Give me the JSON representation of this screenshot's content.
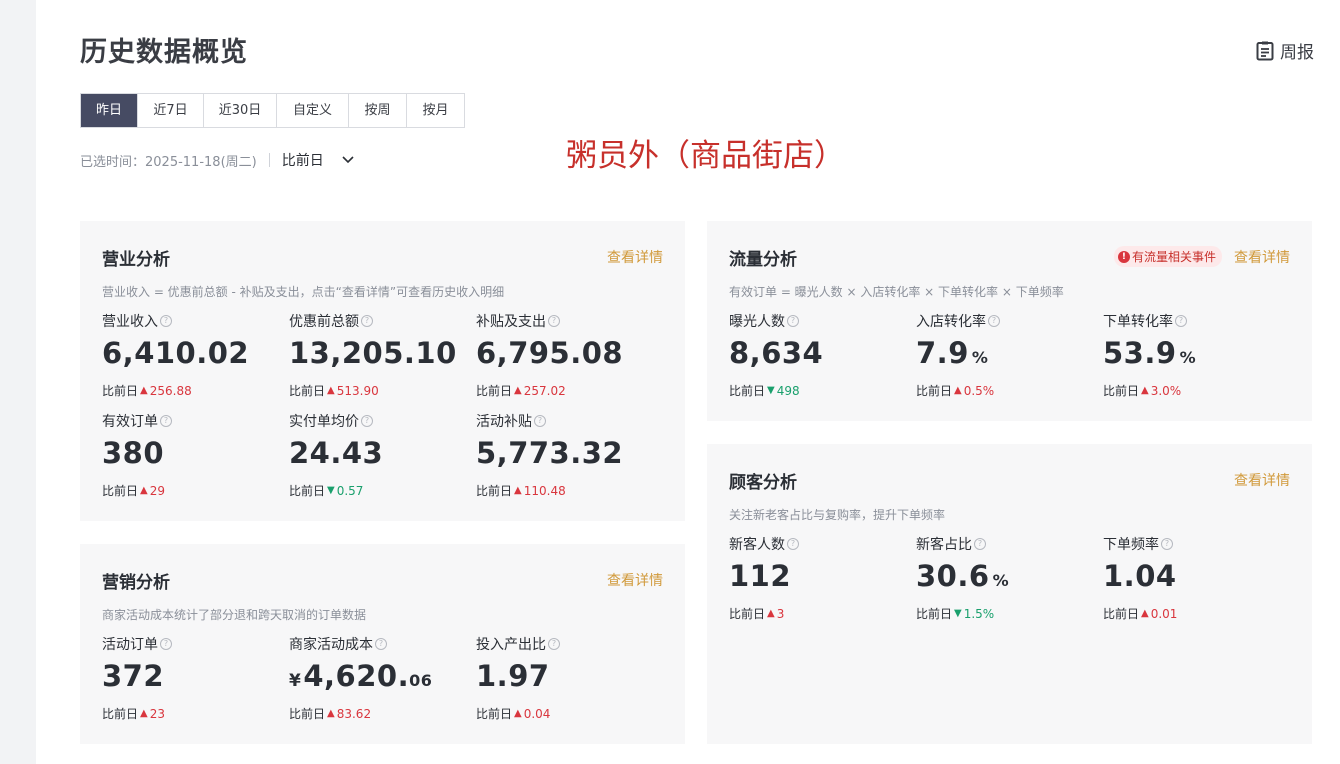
{
  "header": {
    "title": "历史数据概览",
    "weekly_label": "周报"
  },
  "tabs": [
    {
      "label": "昨日",
      "active": true
    },
    {
      "label": "近7日"
    },
    {
      "label": "近30日"
    },
    {
      "label": "自定义"
    },
    {
      "label": "按周"
    },
    {
      "label": "按月"
    }
  ],
  "selected": {
    "label": "已选时间：",
    "date": "2025-11-18(周二)",
    "compare": "比前日"
  },
  "shop_name": "粥员外（商品街店）",
  "colors": {
    "up": "#d9363e",
    "down": "#1aa06d",
    "link": "#d19a3b",
    "active_tab": "#464b63",
    "shop_name": "#c7302b"
  },
  "business": {
    "title": "营业分析",
    "link": "查看详情",
    "desc": "营业收入 = 优惠前总额 - 补贴及支出，点击“查看详情”可查看历史收入明细",
    "metrics": [
      {
        "label": "营业收入",
        "value": "6,410.02",
        "cmp_label": "比前日",
        "dir": "up",
        "delta": "256.88"
      },
      {
        "label": "优惠前总额",
        "value": "13,205.10",
        "cmp_label": "比前日",
        "dir": "up",
        "delta": "513.90"
      },
      {
        "label": "补贴及支出",
        "value": "6,795.08",
        "cmp_label": "比前日",
        "dir": "up",
        "delta": "257.02"
      },
      {
        "label": "有效订单",
        "value": "380",
        "cmp_label": "比前日",
        "dir": "up",
        "delta": "29"
      },
      {
        "label": "实付单均价",
        "value": "24.43",
        "cmp_label": "比前日",
        "dir": "down",
        "delta": "0.57"
      },
      {
        "label": "活动补贴",
        "value": "5,773.32",
        "cmp_label": "比前日",
        "dir": "up",
        "delta": "110.48"
      }
    ]
  },
  "marketing": {
    "title": "营销分析",
    "link": "查看详情",
    "desc": "商家活动成本统计了部分退和跨天取消的订单数据",
    "metrics": [
      {
        "label": "活动订单",
        "value": "372",
        "cmp_label": "比前日",
        "dir": "up",
        "delta": "23"
      },
      {
        "label": "商家活动成本",
        "currency": "¥",
        "value": "4,620.",
        "decimal": "06",
        "cmp_label": "比前日",
        "dir": "up",
        "delta": "83.62"
      },
      {
        "label": "投入产出比",
        "value": "1.97",
        "cmp_label": "比前日",
        "dir": "up",
        "delta": "0.04"
      }
    ]
  },
  "traffic": {
    "title": "流量分析",
    "link": "查看详情",
    "badge": "有流量相关事件",
    "desc": "有效订单 = 曝光人数 × 入店转化率 × 下单转化率 × 下单频率",
    "metrics": [
      {
        "label": "曝光人数",
        "value": "8,634",
        "cmp_label": "比前日",
        "dir": "down",
        "delta": "498"
      },
      {
        "label": "入店转化率",
        "value": "7.9",
        "unit": "%",
        "cmp_label": "比前日",
        "dir": "up",
        "delta": "0.5%"
      },
      {
        "label": "下单转化率",
        "value": "53.9",
        "unit": "%",
        "cmp_label": "比前日",
        "dir": "up",
        "delta": "3.0%"
      }
    ]
  },
  "customer": {
    "title": "顾客分析",
    "link": "查看详情",
    "desc": "关注新老客占比与复购率，提升下单频率",
    "metrics": [
      {
        "label": "新客人数",
        "value": "112",
        "cmp_label": "比前日",
        "dir": "up",
        "delta": "3"
      },
      {
        "label": "新客占比",
        "value": "30.6",
        "unit": "%",
        "cmp_label": "比前日",
        "dir": "down",
        "delta": "1.5%"
      },
      {
        "label": "下单频率",
        "value": "1.04",
        "cmp_label": "比前日",
        "dir": "up",
        "delta": "0.01"
      }
    ]
  }
}
